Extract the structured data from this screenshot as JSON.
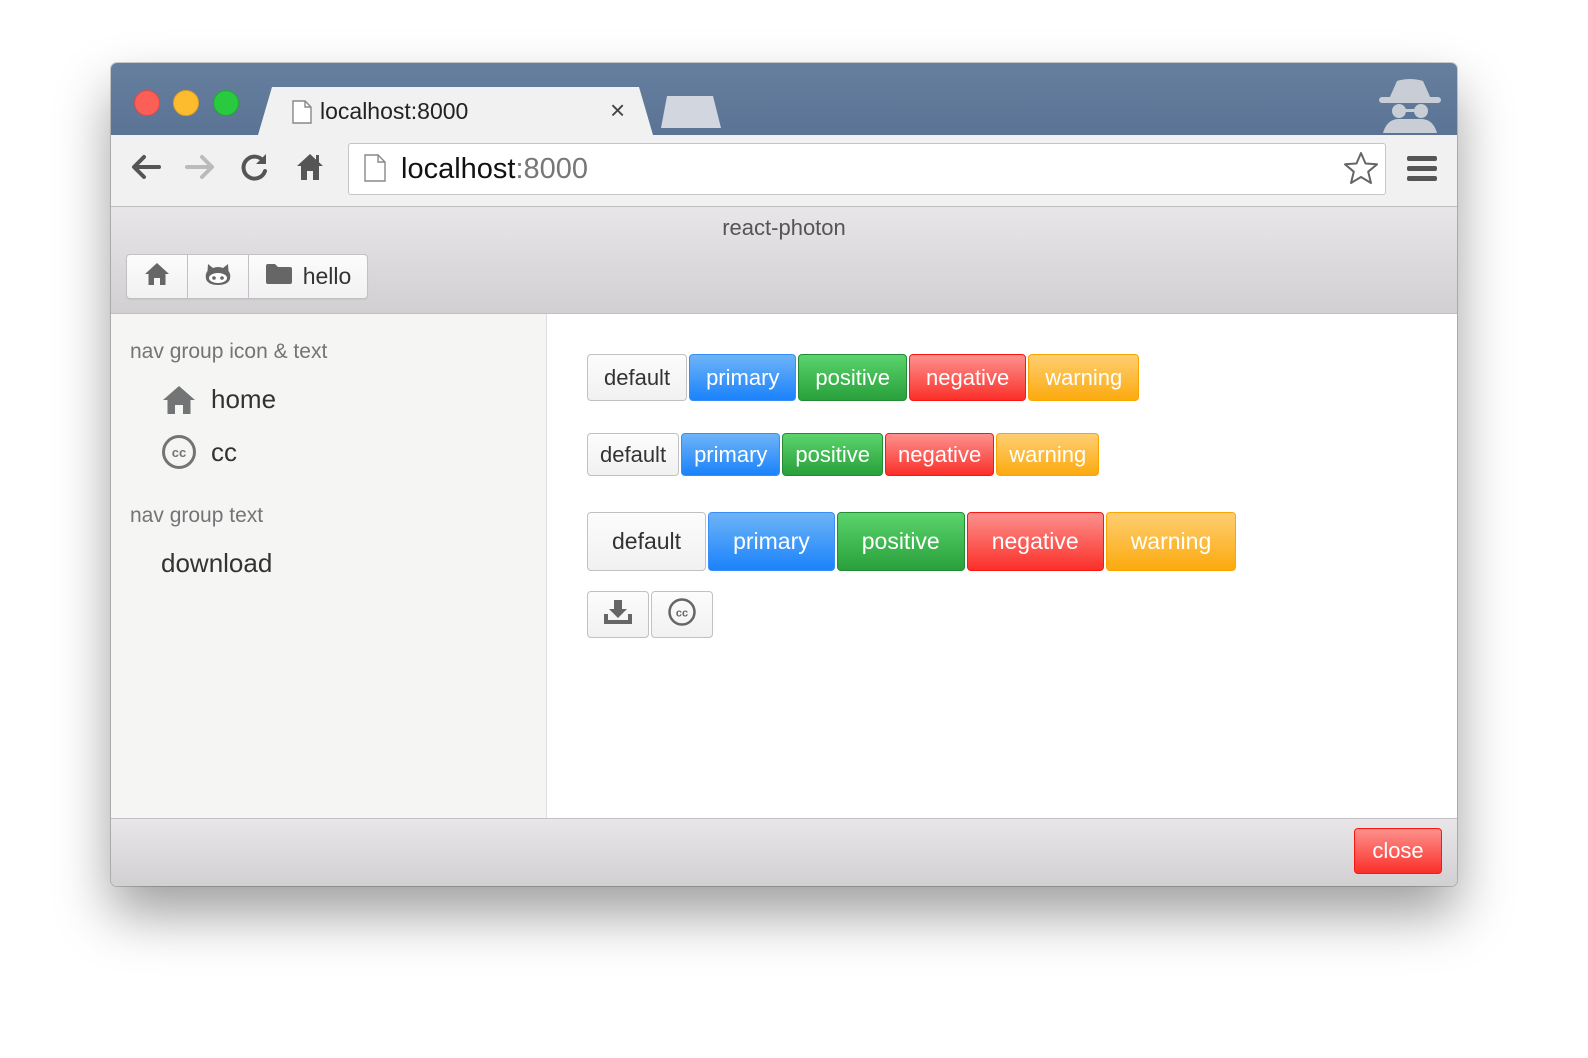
{
  "browser": {
    "tab_title": "localhost:8000",
    "tab_close": "×",
    "url_host": "localhost",
    "url_port": ":8000"
  },
  "app": {
    "title": "react-photon",
    "toolbar_group": {
      "items": [
        {
          "icon": "home-icon"
        },
        {
          "icon": "github-icon"
        },
        {
          "icon": "folder-icon",
          "label": "hello"
        }
      ]
    }
  },
  "sidebar": {
    "groups": [
      {
        "title": "nav group icon & text",
        "items": [
          {
            "icon": "home-icon",
            "label": "home"
          },
          {
            "icon": "creative-commons-icon",
            "label": "cc"
          }
        ]
      },
      {
        "title": "nav group text",
        "items": [
          {
            "label": "download"
          }
        ]
      }
    ]
  },
  "content": {
    "rows": [
      {
        "size": "default",
        "buttons": [
          "default",
          "primary",
          "positive",
          "negative",
          "warning"
        ]
      },
      {
        "size": "mini",
        "buttons": [
          "default",
          "primary",
          "positive",
          "negative",
          "warning"
        ]
      },
      {
        "size": "large",
        "buttons": [
          "default",
          "primary",
          "positive",
          "negative",
          "warning"
        ]
      }
    ],
    "icon_buttons": [
      {
        "icon": "download-icon"
      },
      {
        "icon": "creative-commons-icon"
      }
    ]
  },
  "footer": {
    "close_label": "close"
  },
  "colors": {
    "primary": "#1a82fb",
    "positive": "#29a03b",
    "negative": "#fb2f29",
    "warning": "#fcaa0e",
    "titlebar": "#5b7394"
  }
}
